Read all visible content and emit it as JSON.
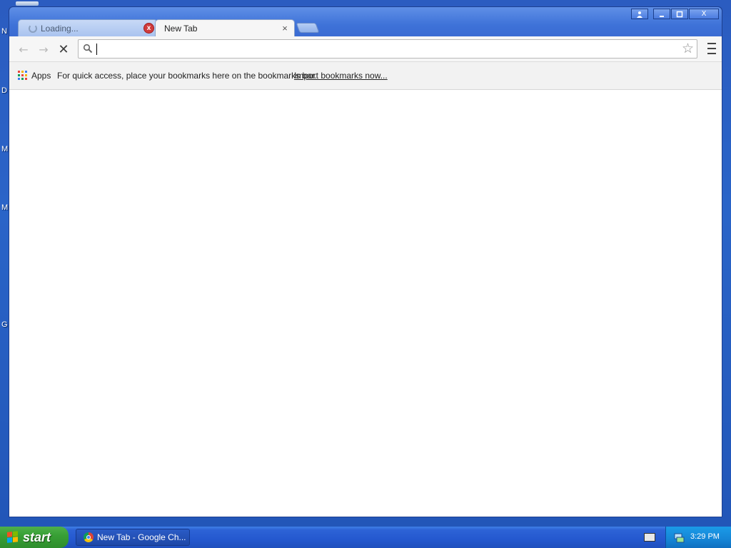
{
  "desktop": {
    "side_letters": [
      "N",
      "D",
      "M",
      "M",
      "G"
    ]
  },
  "window": {
    "controls": {
      "user_icon": "person-icon",
      "minimize": "—",
      "maximize": "▫",
      "close": "X"
    }
  },
  "tabs": [
    {
      "label": "Loading...",
      "icon": "loading-spinner-icon",
      "close": "x",
      "state": "loading"
    },
    {
      "label": "New Tab",
      "close": "×",
      "state": "active"
    }
  ],
  "toolbar": {
    "back": "←",
    "forward": "→",
    "stop": "✕",
    "omnibox": {
      "value": "",
      "placeholder": ""
    },
    "star": "☆"
  },
  "bookmarks": {
    "apps_label": "Apps",
    "hint": "For quick access, place your bookmarks here on the bookmarks bar.",
    "import_link": "Import bookmarks now..."
  },
  "taskbar": {
    "start_label": "start",
    "task_item": "New Tab - Google Ch...",
    "clock": "3:29 PM"
  },
  "colors": {
    "xp_blue": "#2458cf",
    "start_green": "#38a035",
    "tray_blue": "#1585d6",
    "tab_close_red": "#d03b3b"
  }
}
